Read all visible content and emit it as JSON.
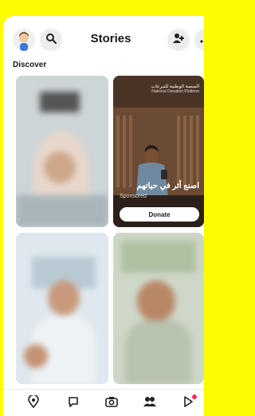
{
  "header": {
    "title": "Stories",
    "icons": [
      "avatar",
      "search-icon",
      "add-friend-icon",
      "more-icon"
    ]
  },
  "discover": {
    "label": "Discover"
  },
  "featured_story": {
    "arabic_title": "اصنع أثر في حياتهم",
    "sponsored_label": "Sponsored",
    "button_label": "Donate",
    "badge": "المنصة الوطنية للتبرعات",
    "badge_en": "National Donation Platform"
  },
  "bottom_nav": {
    "icons": [
      "map-icon",
      "chat-icon",
      "camera-icon",
      "stories-icon",
      "spotlight-icon"
    ],
    "active": "stories-icon"
  },
  "colors": {
    "brand_yellow": "#fffc00",
    "notification_dot": "#ff2d55"
  }
}
